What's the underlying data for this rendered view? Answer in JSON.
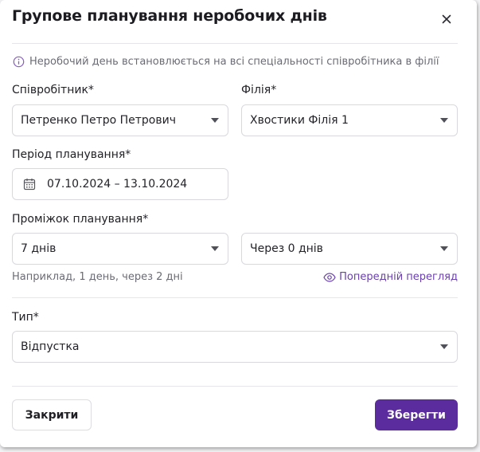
{
  "dialog": {
    "title": "Групове планування неробочих днів",
    "info_text": "Неробочий день встановлюється на всі спеціальності співробітника в філії"
  },
  "employee": {
    "label": "Співробітник*",
    "value": "Петренко Петро Петрович"
  },
  "branch": {
    "label": "Філія*",
    "value": "Хвостики Філія 1"
  },
  "period": {
    "label": "Період планування*",
    "value": "07.10.2024 – 13.10.2024"
  },
  "interval": {
    "label": "Проміжок планування*",
    "duration_value": "7 днів",
    "gap_value": "Через 0 днів",
    "hint": "Наприклад, 1 день, через 2 дні",
    "preview_label": "Попередній перегляд"
  },
  "type": {
    "label": "Тип*",
    "value": "Відпустка"
  },
  "footer": {
    "close_label": "Закрити",
    "save_label": "Зберегти"
  },
  "colors": {
    "accent": "#5b2c9e",
    "link": "#6a3fae",
    "muted_text": "#6b6b75",
    "border": "#d8d8de"
  }
}
